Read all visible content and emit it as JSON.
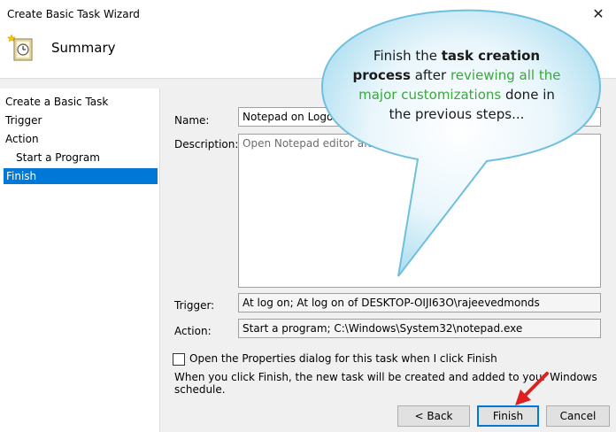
{
  "window": {
    "title": "Create Basic Task Wizard",
    "close_glyph": "✕"
  },
  "header": {
    "heading": "Summary",
    "icon": "task-clock-icon"
  },
  "nav": {
    "items": [
      {
        "label": "Create a Basic Task"
      },
      {
        "label": "Trigger"
      },
      {
        "label": "Action"
      },
      {
        "label": "Start a Program"
      },
      {
        "label": "Finish"
      }
    ]
  },
  "form": {
    "name_label": "Name:",
    "name_value": "Notepad on Logon",
    "description_label": "Description:",
    "description_value": "Open Notepad editor after logging in to Windows.",
    "trigger_label": "Trigger:",
    "trigger_value": "At log on; At log on of DESKTOP-OIJI63O\\rajeevedmonds",
    "action_label": "Action:",
    "action_value": "Start a program; C:\\Windows\\System32\\notepad.exe",
    "open_properties_label": "Open the Properties dialog for this task when I click Finish",
    "open_properties_checked": false,
    "info_text": "When you click Finish, the new task will be created and added to your Windows schedule."
  },
  "buttons": {
    "back": "< Back",
    "finish": "Finish",
    "cancel": "Cancel"
  },
  "callout": {
    "part1": "Finish the ",
    "part2": "task creation process",
    "part3": " after ",
    "part4": "reviewing all the major customizations",
    "part5": " done in the previous steps...",
    "accent_color": "#3aa83a"
  },
  "colors": {
    "selection": "#0078d7",
    "arrow": "#e02020"
  }
}
